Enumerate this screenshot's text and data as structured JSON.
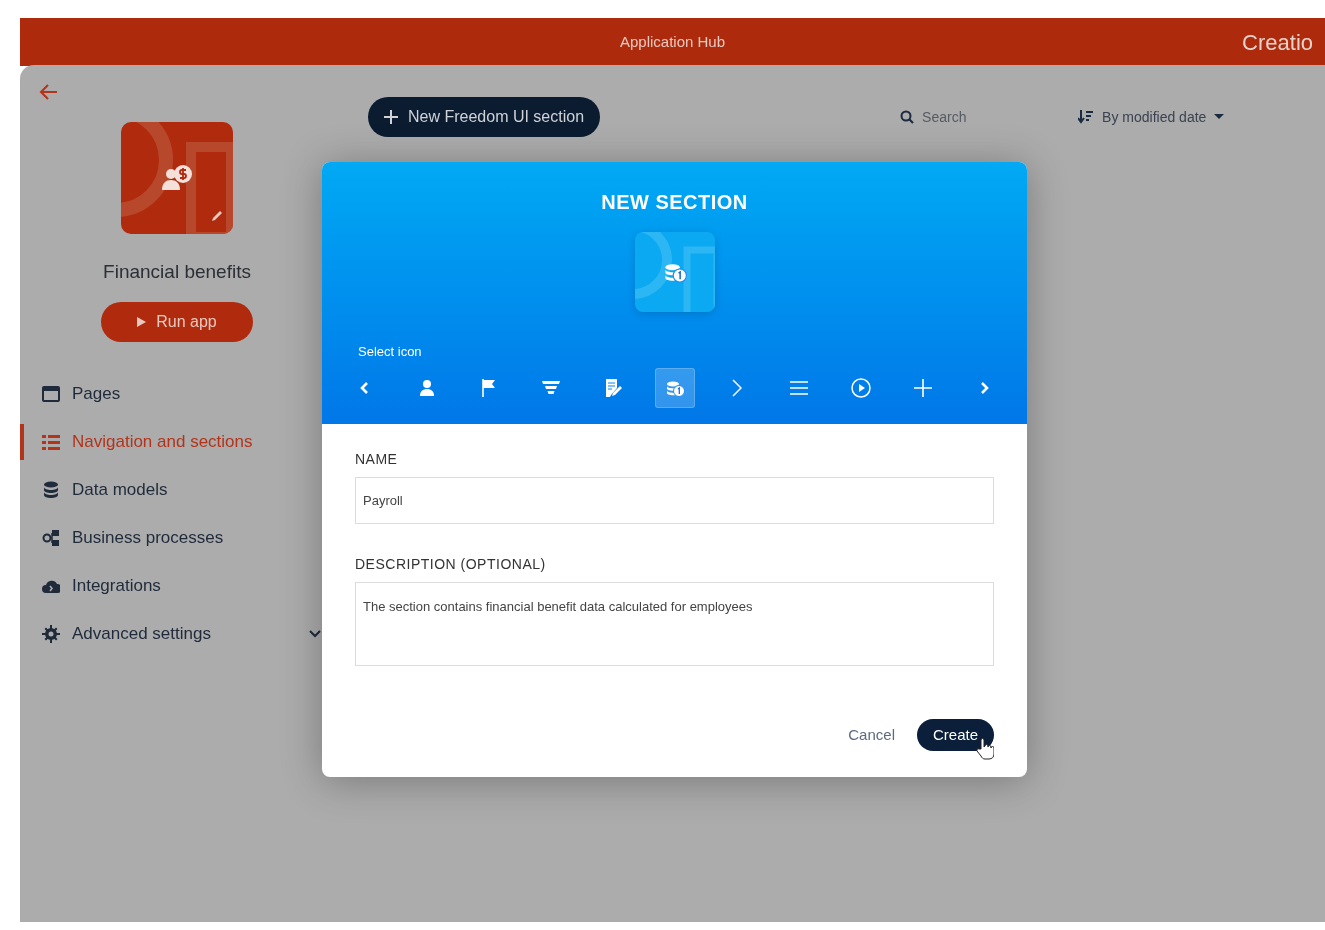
{
  "header": {
    "title": "Application Hub",
    "logo": "Creatio"
  },
  "app": {
    "title": "Financial benefits",
    "run_button": "Run app"
  },
  "sidebar": {
    "items": [
      {
        "label": "Pages",
        "kind": "pages",
        "selected": false
      },
      {
        "label": "Navigation and sections",
        "kind": "navigation",
        "selected": true
      },
      {
        "label": "Data models",
        "kind": "data",
        "selected": false
      },
      {
        "label": "Business processes",
        "kind": "process",
        "selected": false
      },
      {
        "label": "Integrations",
        "kind": "cloud",
        "selected": false
      },
      {
        "label": "Advanced settings",
        "kind": "settings",
        "selected": false,
        "expandable": true
      }
    ]
  },
  "toolbar": {
    "new_button": "New Freedom UI section",
    "search": {
      "placeholder": "Search"
    },
    "sort": "By modified date"
  },
  "dialog": {
    "title": "NEW SECTION",
    "select_icon_label": "Select icon",
    "icons": [
      {
        "kind": "prev",
        "selected": false
      },
      {
        "kind": "person",
        "selected": false
      },
      {
        "kind": "flag",
        "selected": false
      },
      {
        "kind": "funnel",
        "selected": false
      },
      {
        "kind": "note",
        "selected": false
      },
      {
        "kind": "coins",
        "selected": true
      },
      {
        "kind": "chevron",
        "selected": false
      },
      {
        "kind": "menu",
        "selected": false
      },
      {
        "kind": "play",
        "selected": false
      },
      {
        "kind": "plus",
        "selected": false
      },
      {
        "kind": "next",
        "selected": false
      }
    ],
    "name_label": "NAME",
    "name_value": "Payroll",
    "description_label": "DESCRIPTION (OPTIONAL)",
    "description_value": "The section contains financial benefit data calculated for employees",
    "cancel_button": "Cancel",
    "create_button": "Create"
  }
}
